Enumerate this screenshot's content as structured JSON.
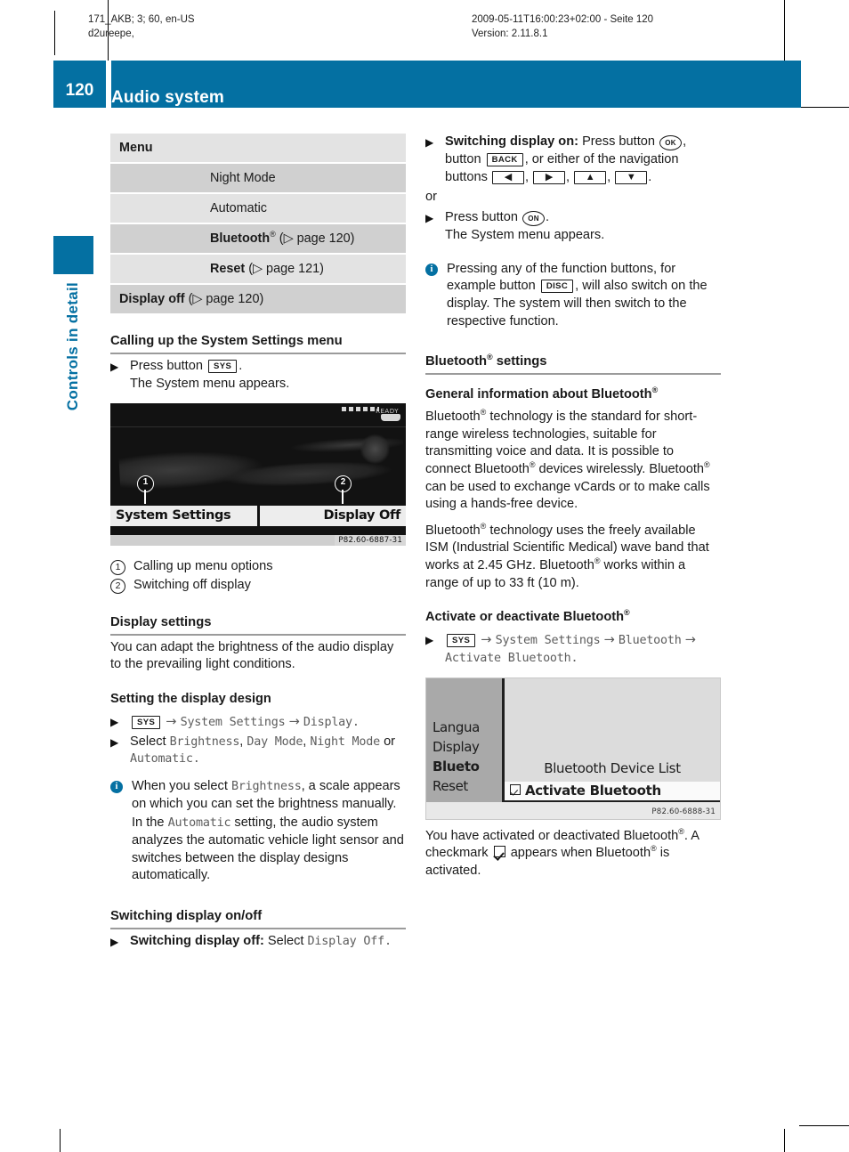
{
  "running_head": {
    "left_line1": "171_AKB; 3; 60, en-US",
    "left_line2": "d2ureepe,",
    "center_line1": "2009-05-11T16:00:23+02:00 - Seite 120",
    "center_line2": "Version: 2.11.8.1"
  },
  "header": {
    "page_number": "120",
    "title": "Audio system",
    "chapter_tab": "Controls in detail",
    "accent_color": "#0470a2"
  },
  "left_column": {
    "menu_table": {
      "header_label": "Menu",
      "rows": [
        {
          "label": "Night Mode",
          "indent": true,
          "bold": false,
          "ref": ""
        },
        {
          "label": "Automatic",
          "indent": true,
          "bold": false,
          "ref": ""
        },
        {
          "label": "Bluetooth",
          "registered": true,
          "indent": true,
          "bold": true,
          "ref": "(▷ page 120)"
        },
        {
          "label": "Reset",
          "indent": true,
          "bold": true,
          "ref": "(▷ page 121)"
        },
        {
          "label": "Display off",
          "indent": false,
          "bold": true,
          "ref": "(▷ page 120)"
        }
      ]
    },
    "calling_up_heading": "Calling up the System Settings menu",
    "press_button_prefix": "Press button",
    "sys_button": "SYS",
    "press_button_suffix": ".",
    "system_menu_appears": "The System menu appears.",
    "figure1": {
      "status_text": "READY",
      "tab_left": "System Settings",
      "tab_right": "Display Off",
      "callout_1": "1",
      "callout_2": "2",
      "caption": "P82.60-6887-31"
    },
    "legend": [
      {
        "num": "1",
        "text": "Calling up menu options"
      },
      {
        "num": "2",
        "text": "Switching off display"
      }
    ],
    "display_settings_heading": "Display settings",
    "display_settings_body": "You can adapt the brightness of the audio display to the prevailing light conditions.",
    "setting_design_heading": "Setting the display design",
    "path_step": {
      "button": "SYS",
      "arrow": "→",
      "part1": "System Settings",
      "part2": "Display",
      "end": "."
    },
    "select_step": {
      "prefix": "Select",
      "opt1": "Brightness",
      "opt2": "Day Mode",
      "opt3": "Night Mode",
      "or": "or",
      "opt4": "Automatic",
      "end": "."
    },
    "note1": {
      "line1_a": "When you select",
      "line1_mono": "Brightness",
      "line1_b": ", a scale appears on which you can set the brightness manually.",
      "line2_a": "In the",
      "line2_mono": "Automatic",
      "line2_b": " setting, the audio system analyzes the automatic vehicle light sensor and switches between the display designs automatically."
    },
    "switching_heading": "Switching display on/off",
    "switch_off_step": {
      "bold": "Switching display off:",
      "text": "Select",
      "mono": "Display Off",
      "end": "."
    }
  },
  "right_column": {
    "switch_on_step": {
      "bold": "Switching display on:",
      "t1": "Press button",
      "btn_ok": "OK",
      "t2": ", button",
      "btn_back": "BACK",
      "t3": ", or either of the navigation buttons",
      "nav_left": "◀",
      "nav_right": "▶",
      "nav_up": "▲",
      "nav_down": "▼",
      "end": "."
    },
    "or_text": "or",
    "press_on_step": {
      "t1": "Press button",
      "btn_on": "ON",
      "end": ".",
      "t2": "The System menu appears."
    },
    "note_function_buttons": {
      "a": "Pressing any of the function buttons, for example button",
      "btn_disc": "DISC",
      "b": ", will also switch on the display. The system will then switch to the respective function."
    },
    "bluetooth_settings_heading": "Bluetooth",
    "bluetooth_settings_heading_suffix": " settings",
    "general_info_heading": "General information about Bluetooth",
    "general_paragraph_1": [
      "Bluetooth",
      " technology is the standard for short-range wireless technologies, suitable for transmitting voice and data. It is possible to connect Bluetooth",
      " devices wirelessly. Bluetooth",
      " can be used to exchange vCards or to make calls using a hands-free device."
    ],
    "general_paragraph_2": [
      "Bluetooth",
      " technology uses the freely available ISM (Industrial Scientific Medical) wave band that works at 2.45 GHz. Bluetooth",
      " works within a range of up to 33 ft (10 m)."
    ],
    "activate_heading": "Activate or deactivate Bluetooth",
    "activate_path": {
      "button": "SYS",
      "arrow": "→",
      "part1": "System Settings",
      "part2": "Bluetooth",
      "part3": "Activate Bluetooth",
      "end": "."
    },
    "figure2": {
      "menu_items": [
        "Langua",
        "Display",
        "Blueto",
        "Reset"
      ],
      "selected_index": 2,
      "right_item_1": "Bluetooth Device List",
      "right_item_2": "Activate Bluetooth",
      "caption": "P82.60-6888-31"
    },
    "closing_paragraph": {
      "a": "You have activated or deactivated Bluetooth",
      "b": ". A checkmark",
      "c": "appears when Bluetooth",
      "d": " is activated."
    }
  }
}
